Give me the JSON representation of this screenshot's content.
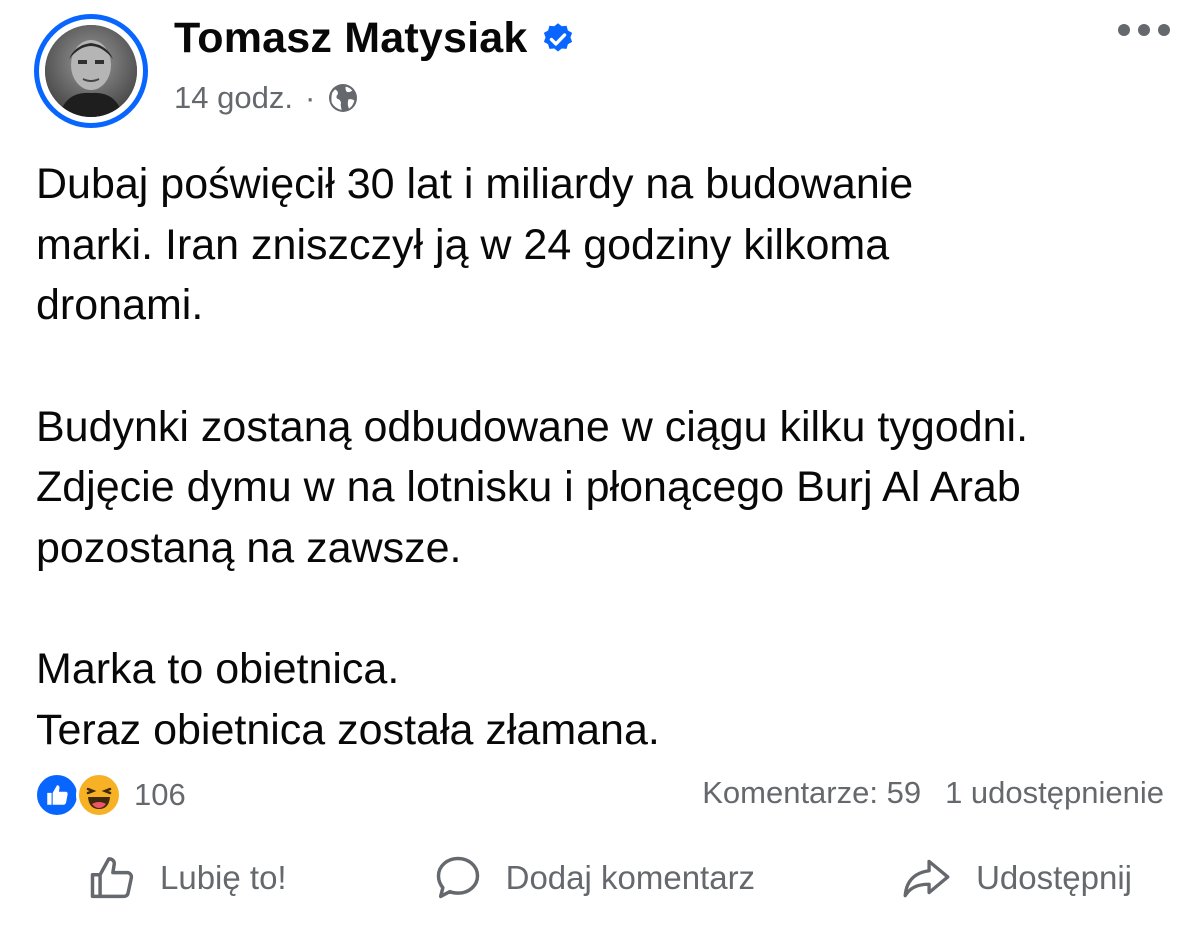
{
  "post": {
    "author": "Tomasz Matysiak",
    "time": "14 godz.",
    "separator": "·",
    "paragraphs": [
      {
        "lines": [
          "Dubaj poświęcił 30 lat i miliardy na budowanie",
          "marki. Iran zniszczył ją w 24 godziny kilkoma",
          "dronami."
        ]
      },
      {
        "lines": [
          "Budynki zostaną odbudowane w ciągu kilku tygodni.",
          "Zdjęcie dymu w na lotnisku i płonącego Burj Al Arab",
          "pozostaną na zawsze."
        ]
      },
      {
        "lines": [
          "Marka to obietnica.",
          "Teraz obietnica została złamana."
        ]
      }
    ],
    "reactions": {
      "count": "106"
    },
    "comments": "Komentarze: 59",
    "shares": "1 udostępnienie"
  },
  "actions": {
    "like": "Lubię to!",
    "comment": "Dodaj komentarz",
    "share": "Udostępnij"
  },
  "colors": {
    "accent": "#0866ff",
    "secondary_text": "#65686c",
    "primary_text": "#080809"
  },
  "icons": {
    "verified": "verified-badge-icon",
    "audience": "globe-icon",
    "more": "more-options-icon",
    "like": "like-icon",
    "haha": "haha-icon",
    "comment": "comment-icon",
    "share": "share-icon"
  }
}
